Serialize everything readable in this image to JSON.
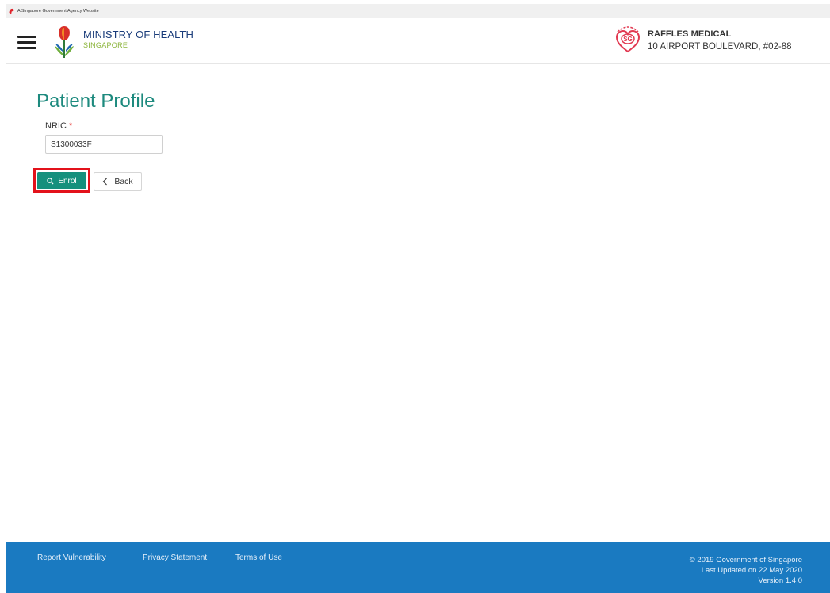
{
  "gov_bar": {
    "text": "A Singapore Government Agency Website"
  },
  "header": {
    "agency_title": "MINISTRY OF HEALTH",
    "agency_subtitle": "SINGAPORE",
    "clinic_name": "RAFFLES MEDICAL",
    "clinic_address": "10 AIRPORT BOULEVARD, #02-88"
  },
  "main": {
    "title": "Patient Profile",
    "nric_label": "NRIC",
    "nric_required_mark": "*",
    "nric_value": "S1300033F",
    "enrol_label": "Enrol",
    "back_label": "Back"
  },
  "footer": {
    "links": [
      "Report Vulnerability",
      "Privacy Statement",
      "Terms of Use"
    ],
    "copyright": "© 2019 Government of Singapore",
    "last_updated": "Last Updated on 22 May 2020",
    "version": "Version 1.4.0"
  },
  "colors": {
    "brand_teal": "#15907d",
    "title_teal": "#1d8a7e",
    "footer_blue": "#1a7ac1",
    "highlight_red": "#e3121b"
  },
  "icons": [
    "lion-head-icon",
    "hamburger-menu-icon",
    "moh-logo-icon",
    "healthier-sg-logo-icon",
    "search-icon",
    "chevron-left-icon"
  ]
}
